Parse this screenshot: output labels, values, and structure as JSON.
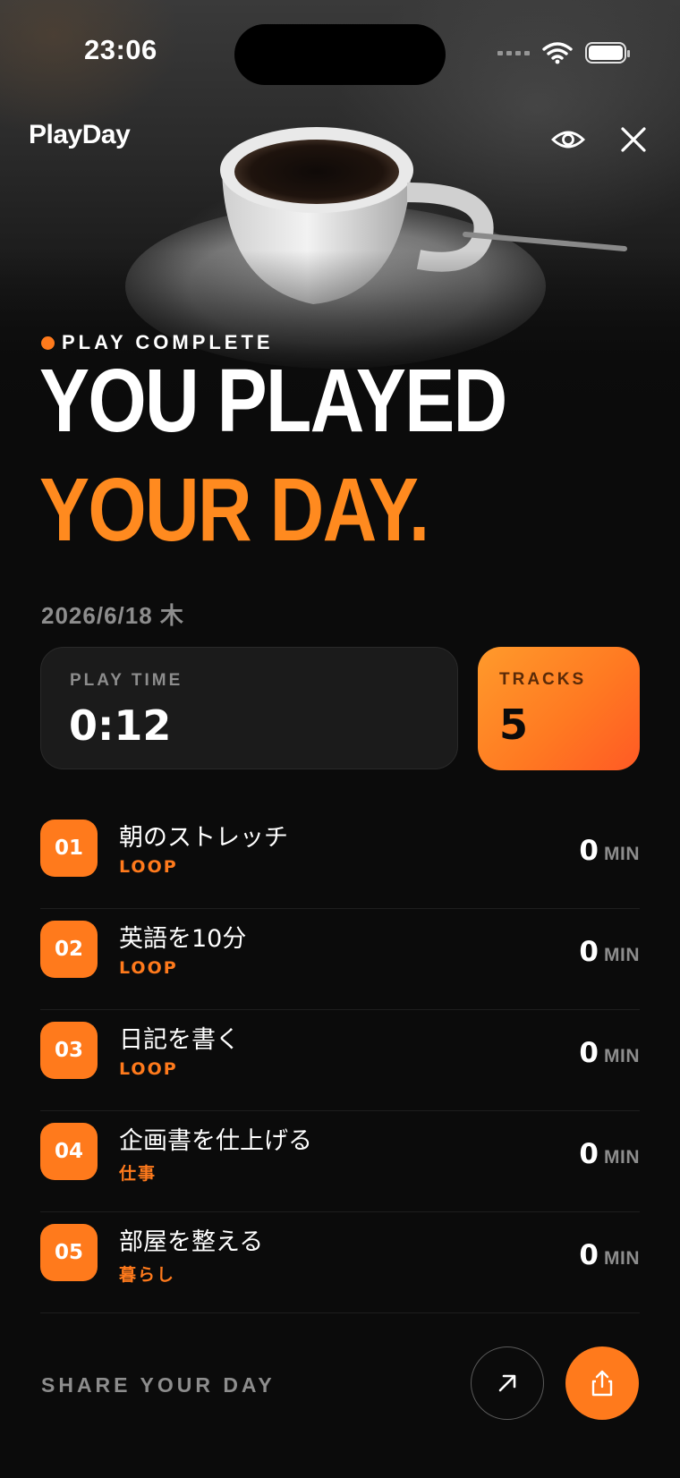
{
  "status_bar": {
    "time": "23:06"
  },
  "header": {
    "logo": "PlayDay",
    "eye_icon": "eye-icon",
    "close_icon": "close-icon"
  },
  "hero": {
    "eyebrow": "PLAY COMPLETE",
    "headline_line1": "YOU PLAYED",
    "headline_line2": "YOUR DAY."
  },
  "date": "2026/6/18 木",
  "stats": {
    "play_time_label": "PLAY TIME",
    "play_time_value": "0:12",
    "tracks_label": "TRACKS",
    "tracks_value": "5"
  },
  "tracks": [
    {
      "num": "01",
      "title": "朝のストレッチ",
      "tag": "LOOP",
      "minutes": "0",
      "unit": "MIN"
    },
    {
      "num": "02",
      "title": "英語を10分",
      "tag": "LOOP",
      "minutes": "0",
      "unit": "MIN"
    },
    {
      "num": "03",
      "title": "日記を書く",
      "tag": "LOOP",
      "minutes": "0",
      "unit": "MIN"
    },
    {
      "num": "04",
      "title": "企画書を仕上げる",
      "tag": "仕事",
      "minutes": "0",
      "unit": "MIN"
    },
    {
      "num": "05",
      "title": "部屋を整える",
      "tag": "暮らし",
      "minutes": "0",
      "unit": "MIN"
    }
  ],
  "footer": {
    "share_label": "SHARE YOUR DAY",
    "open_icon": "arrow-up-right-icon",
    "share_icon": "share-icon"
  },
  "colors": {
    "accent": "#ff7a1c",
    "background": "#0b0b0b",
    "card": "#1b1b1b",
    "muted": "#8d8d8d"
  }
}
